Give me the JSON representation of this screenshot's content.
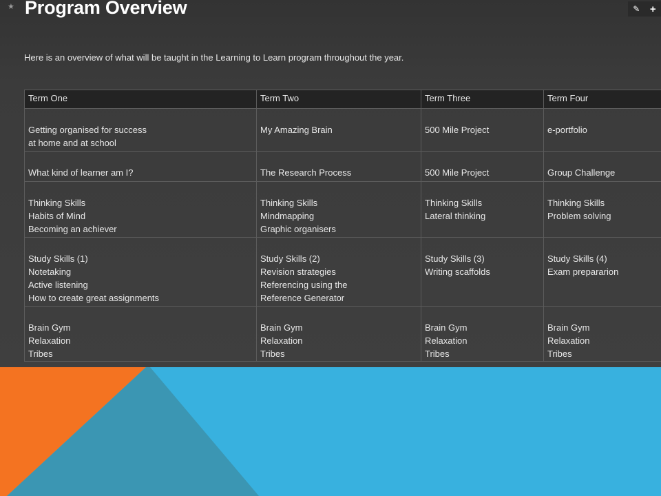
{
  "page": {
    "title": "Program Overview",
    "intro": "Here is an overview of what will be taught in the Learning to Learn program throughout the year."
  },
  "toolbar": {
    "edit_icon": "pencil-icon",
    "add_icon": "plus-icon",
    "edit_glyph": "✎",
    "add_glyph": "+"
  },
  "table": {
    "headers": [
      "Term One",
      "Term Two",
      "Term Three",
      "Term Four"
    ],
    "rows": [
      [
        [
          "Getting organised for success",
          "at home and at school"
        ],
        [
          "My Amazing Brain"
        ],
        [
          "500 Mile Project"
        ],
        [
          "e-portfolio"
        ]
      ],
      [
        [
          "What kind of learner am I?"
        ],
        [
          "The Research Process"
        ],
        [
          "500 Mile Project"
        ],
        [
          "Group Challenge"
        ]
      ],
      [
        [
          "Thinking Skills",
          "Habits of Mind",
          "Becoming an achiever"
        ],
        [
          "Thinking Skills",
          "Mindmapping",
          "Graphic organisers"
        ],
        [
          "Thinking Skills",
          "Lateral thinking"
        ],
        [
          "Thinking Skills",
          "Problem solving"
        ]
      ],
      [
        [
          "Study Skills (1)",
          "Notetaking",
          "Active listening",
          "How to create great assignments"
        ],
        [
          "Study Skills (2)",
          "Revision strategies",
          "Referencing using the",
          "Reference Generator"
        ],
        [
          "Study Skills (3)",
          "Writing scaffolds"
        ],
        [
          "Study Skills (4)",
          "Exam prepararion"
        ]
      ],
      [
        [
          "Brain Gym",
          "Relaxation",
          "Tribes"
        ],
        [
          "Brain Gym",
          "Relaxation",
          "Tribes"
        ],
        [
          "Brain Gym",
          "Relaxation",
          "Tribes"
        ],
        [
          "Brain Gym",
          "Relaxation",
          "Tribes"
        ]
      ]
    ]
  },
  "colors": {
    "background": "#3a3a3a",
    "header_row": "#232323",
    "orange": "#f47321",
    "blue": "#38b1df",
    "teal_overlay": "#3b96b3"
  }
}
